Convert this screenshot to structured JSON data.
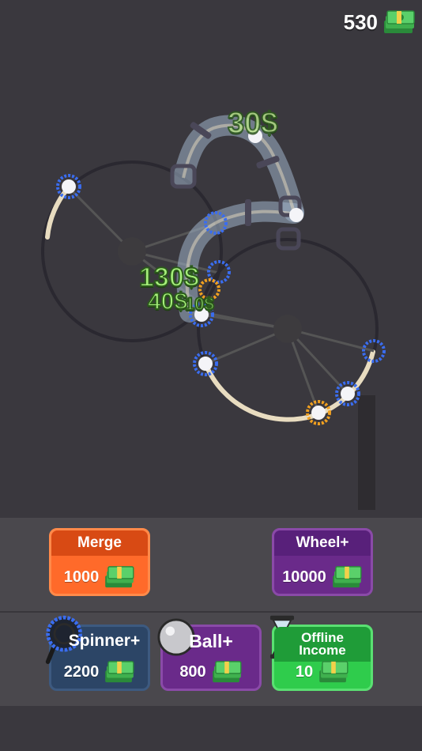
{
  "hud": {
    "money": "530",
    "money_icon": "cash-stack-icon"
  },
  "floating_rewards": [
    "30$",
    "130$",
    "40$",
    "10$"
  ],
  "buttons": {
    "merge": {
      "label": "Merge",
      "price": "1000"
    },
    "wheel": {
      "label": "Wheel+",
      "price": "10000"
    },
    "spinner": {
      "label": "Spinner+",
      "price": "2200"
    },
    "ball": {
      "label": "Ball+",
      "price": "800"
    },
    "offline": {
      "label_line1": "Offline",
      "label_line2": "Income",
      "price": "10"
    }
  },
  "colors": {
    "background": "#3a383e",
    "merge": "#ff6a2a",
    "wheel": "#6a2a8a",
    "spinner": "#2c4566",
    "ball": "#6a2a8a",
    "offline": "#2fcc4c",
    "reward_text": "#a6f07a"
  }
}
